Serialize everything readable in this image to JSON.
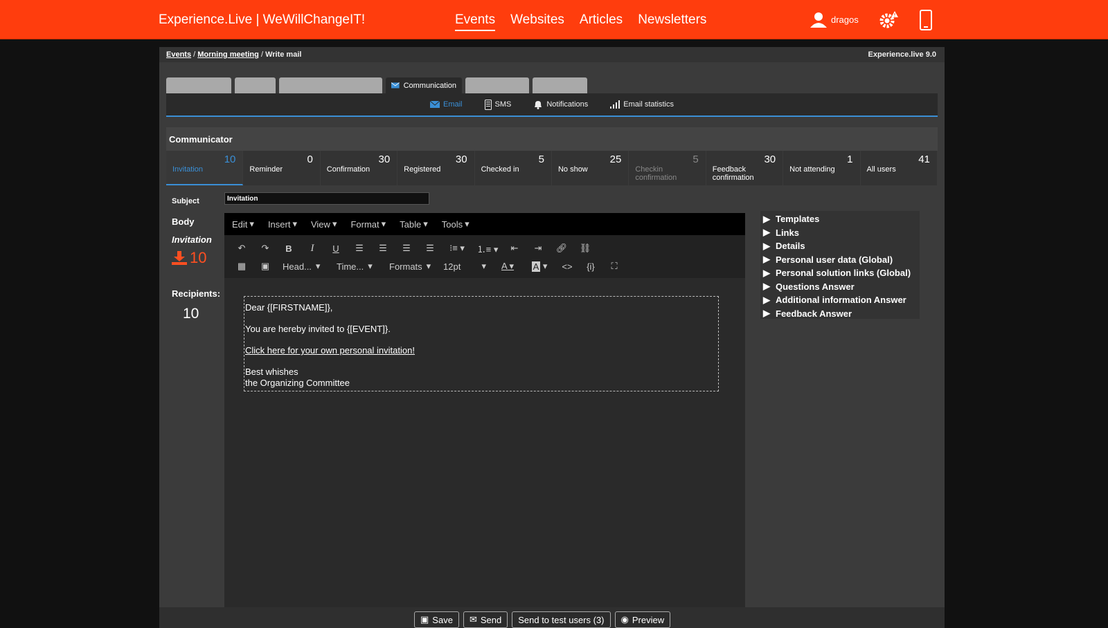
{
  "header": {
    "brand": "Experience.Live | WeWillChangeIT!",
    "nav": [
      "Events",
      "Websites",
      "Articles",
      "Newsletters"
    ],
    "user": "dragos",
    "accent": "#ff3d0d"
  },
  "breadcrumb": {
    "items": [
      "Events",
      "Morning meeting"
    ],
    "separator": "/",
    "current": "Write mail",
    "version": "Experience.live 9.0"
  },
  "tabs": {
    "active": "Communication"
  },
  "subtabs": [
    "Email",
    "SMS",
    "Notifications",
    "Email statistics"
  ],
  "communicator": {
    "title": "Communicator",
    "categories": [
      {
        "label": "Invitation",
        "count": "10"
      },
      {
        "label": "Reminder",
        "count": "0"
      },
      {
        "label": "Confirmation",
        "count": "30"
      },
      {
        "label": "Registered",
        "count": "30"
      },
      {
        "label": "Checked in",
        "count": "5"
      },
      {
        "label": "No show",
        "count": "25"
      },
      {
        "label": "Checkin confirmation",
        "count": "5"
      },
      {
        "label": "Feedback confirmation",
        "count": "30"
      },
      {
        "label": "Not attending",
        "count": "1"
      },
      {
        "label": "All users",
        "count": "41"
      }
    ]
  },
  "form": {
    "subject_label": "Subject",
    "subject_value": "Invitation",
    "body_label": "Body",
    "template_name": "Invitation",
    "download_count": "10",
    "recipients_label": "Recipients:",
    "recipients_count": "10"
  },
  "editor": {
    "menus": [
      "Edit",
      "Insert",
      "View",
      "Format",
      "Table",
      "Tools"
    ],
    "dropdowns": [
      "Head...",
      "Time...",
      "Formats",
      "12pt"
    ],
    "content": {
      "greeting": "Dear {[FIRSTNAME]},",
      "line1": "You are hereby invited to {[EVENT]}.",
      "link": "Click here for your own personal invitation!",
      "closing1": "Best whishes",
      "closing2": "the Organizing Committee"
    }
  },
  "sidebar": {
    "items": [
      "Templates",
      "Links",
      "Details",
      "Personal user data (Global)",
      "Personal solution links (Global)",
      "Questions Answer",
      "Additional information Answer",
      "Feedback Answer"
    ]
  },
  "actions": {
    "save": "Save",
    "send": "Send",
    "send_test": "Send to test users (3)",
    "preview": "Preview"
  }
}
